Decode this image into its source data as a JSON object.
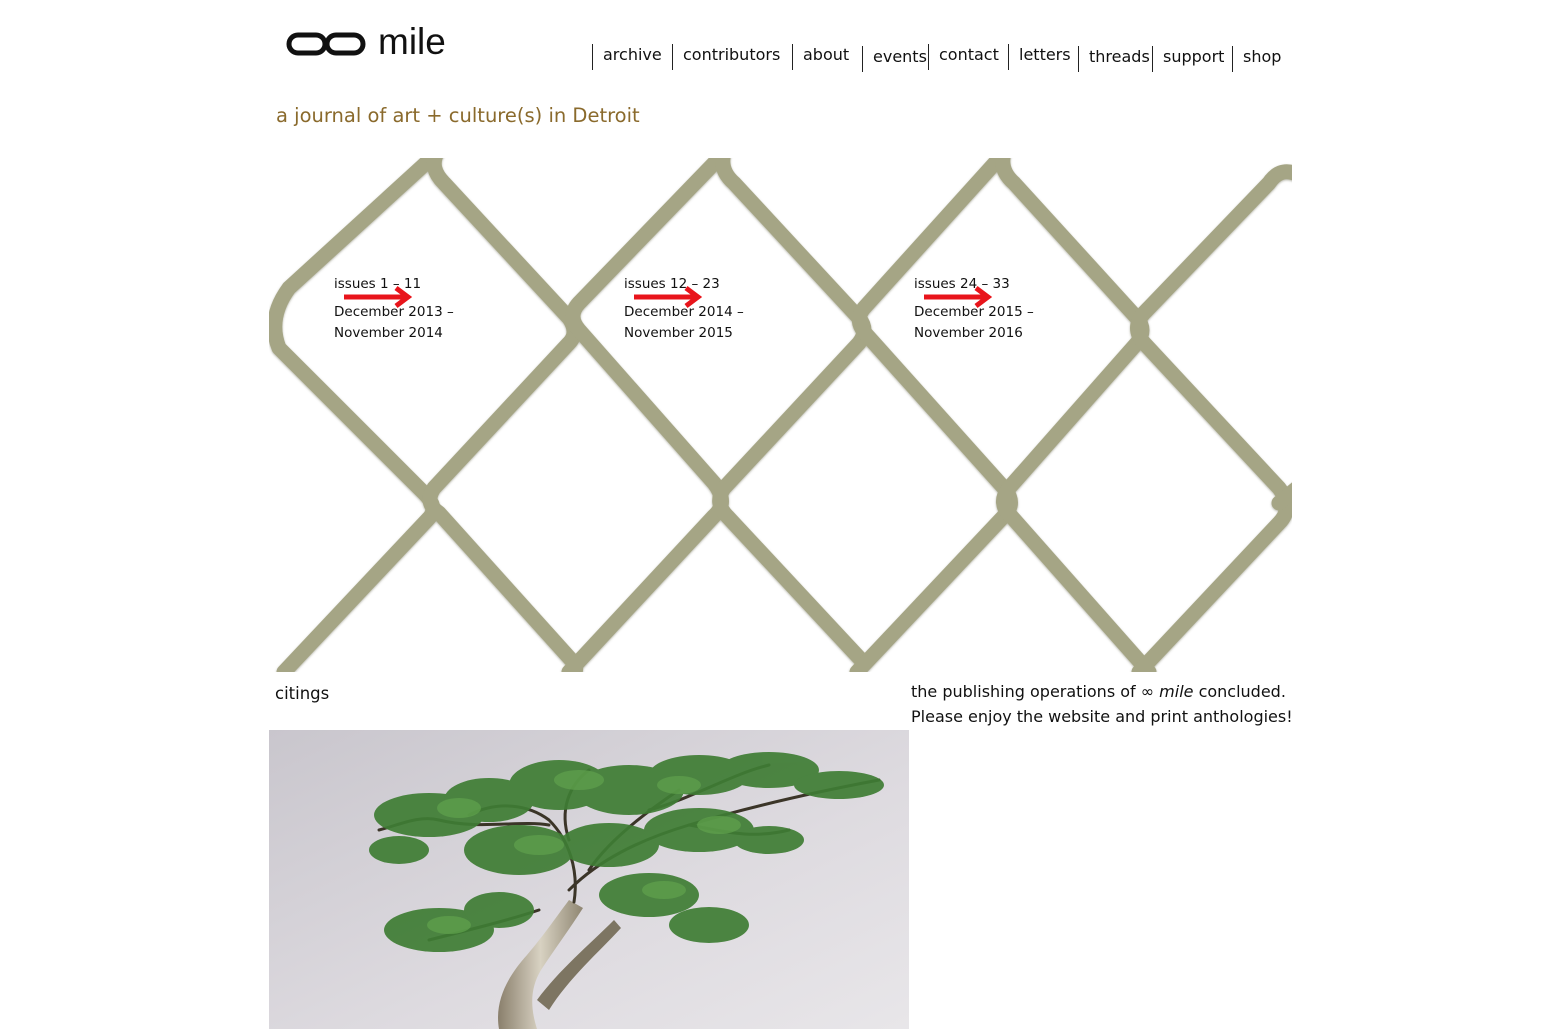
{
  "site": {
    "logo_symbol": "∞",
    "logo_text": "mile",
    "tagline": "a journal of art + culture(s) in Detroit"
  },
  "nav": [
    {
      "label": "archive"
    },
    {
      "label": "contributors"
    },
    {
      "label": "about"
    },
    {
      "label": "events"
    },
    {
      "label": "contact"
    },
    {
      "label": "letters"
    },
    {
      "label": "threads"
    },
    {
      "label": "support"
    },
    {
      "label": "shop"
    }
  ],
  "issues": [
    {
      "range": "issues 1 – 11",
      "dates": "December 2013 – November 2014",
      "arrow_icon": "right-arrow-icon"
    },
    {
      "range": "issues 12 – 23",
      "dates": "December 2014 – November 2015",
      "arrow_icon": "right-arrow-icon"
    },
    {
      "range": "issues 24 – 33",
      "dates": "December 2015 – November 2016",
      "arrow_icon": "right-arrow-icon"
    }
  ],
  "citings": {
    "label": "citings"
  },
  "notice": {
    "before": "the publishing operations of ",
    "emphasis": "∞ mile",
    "after": " concluded.",
    "line2": "Please enjoy the website and print anthologies!"
  },
  "colors": {
    "tagline": "#8a6a2c",
    "fence_wire": "#a5a585",
    "arrow": "#e8141b",
    "text": "#111111",
    "background": "#ffffff"
  }
}
